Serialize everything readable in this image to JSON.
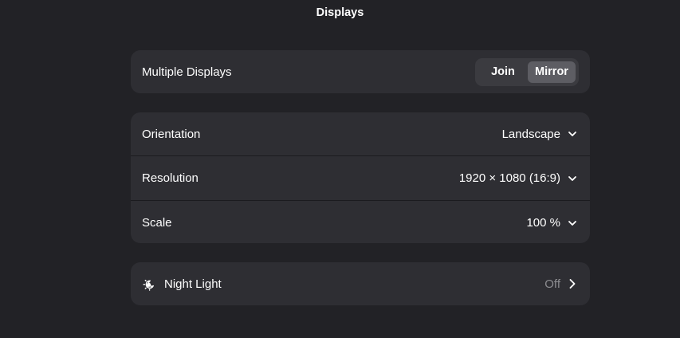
{
  "header": {
    "title": "Displays"
  },
  "multiple_displays": {
    "label": "Multiple Displays",
    "options": [
      "Join",
      "Mirror"
    ],
    "selected": "Mirror"
  },
  "display_settings": {
    "orientation": {
      "label": "Orientation",
      "value": "Landscape"
    },
    "resolution": {
      "label": "Resolution",
      "value": "1920 × 1080 (16:9)"
    },
    "scale": {
      "label": "Scale",
      "value": "100 %"
    }
  },
  "night_light": {
    "label": "Night Light",
    "value": "Off"
  },
  "icons": {
    "dropdown": "chevron-down-icon",
    "navigate": "chevron-right-icon",
    "night_light": "night-light-icon"
  },
  "colors": {
    "background": "#222226",
    "card": "#2e2e33",
    "toggle_bg": "#3b3b40",
    "toggle_selected": "#5d5d63",
    "dim_text": "#8c8c90"
  }
}
